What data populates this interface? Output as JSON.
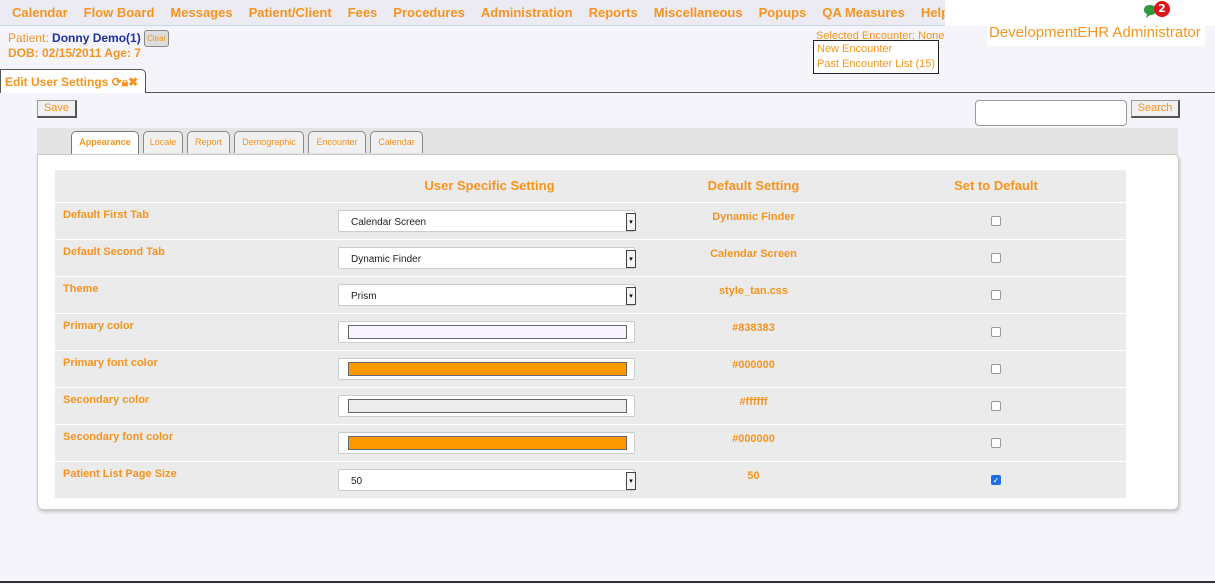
{
  "menu": [
    "Calendar",
    "Flow Board",
    "Messages",
    "Patient/Client",
    "Fees",
    "Procedures",
    "Administration",
    "Reports",
    "Miscellaneous",
    "Popups",
    "QA Measures",
    "Help"
  ],
  "notifications": {
    "count": "2"
  },
  "user": {
    "name": "DevelopmentEHR Administrator"
  },
  "patient": {
    "label": "Patient:",
    "name": "Donny Demo(1)",
    "clear_label": "Clear",
    "dob_line": "DOB: 02/15/2011 Age: 7"
  },
  "encounter": {
    "selected": "Selected Encounter: None",
    "new": "New Encounter",
    "past": "Past Encounter List (15)"
  },
  "page_tab": {
    "title": "Edit User Settings"
  },
  "toolbar": {
    "save_label": "Save",
    "search_label": "Search",
    "search_value": ""
  },
  "subtabs": [
    "Appearance",
    "Locale",
    "Report",
    "Demographic",
    "Encounter",
    "Calendar"
  ],
  "table": {
    "headers": [
      "",
      "User Specific Setting",
      "Default Setting",
      "Set to Default"
    ],
    "rows": [
      {
        "label": "Default First Tab",
        "type": "select",
        "value": "Calendar Screen",
        "default": "Dynamic Finder",
        "checked": false
      },
      {
        "label": "Default Second Tab",
        "type": "select",
        "value": "Dynamic Finder",
        "default": "Calendar Screen",
        "checked": false
      },
      {
        "label": "Theme",
        "type": "select",
        "value": "Prism",
        "default": "style_tan.css",
        "checked": false
      },
      {
        "label": "Primary color",
        "type": "color",
        "color": "#f7f4ff",
        "default": "#838383",
        "checked": false
      },
      {
        "label": "Primary font color",
        "type": "color",
        "color": "#ff9900",
        "default": "#000000",
        "checked": false
      },
      {
        "label": "Secondary color",
        "type": "color",
        "color": "#ececec",
        "default": "#ffffff",
        "checked": false
      },
      {
        "label": "Secondary font color",
        "type": "color",
        "color": "#ff9900",
        "default": "#000000",
        "checked": false
      },
      {
        "label": "Patient List Page Size",
        "type": "select",
        "value": "50",
        "default": "50",
        "checked": true
      }
    ]
  },
  "colors": {
    "accent": "#f7941d",
    "patient_name": "#1c2fa3",
    "badge": "#e3111a"
  }
}
